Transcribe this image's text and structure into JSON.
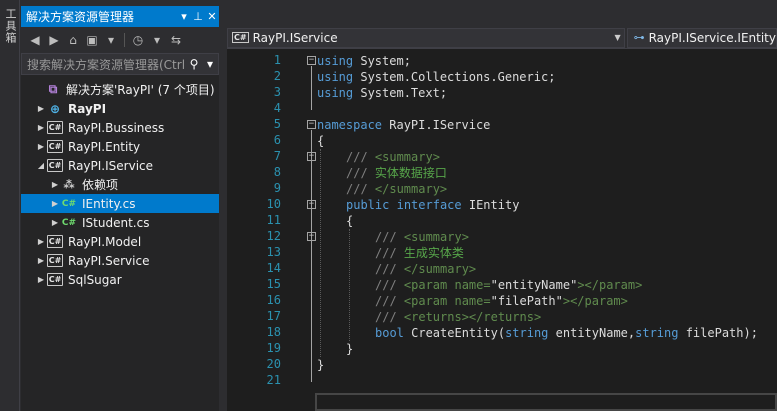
{
  "toolbox": {
    "label": "工具箱"
  },
  "explorer": {
    "title": "解决方案资源管理器",
    "title_buttons": [
      "▾",
      "✕"
    ],
    "search_placeholder": "搜索解决方案资源管理器(Ctrl",
    "tree": [
      {
        "label": "解决方案'RayPI' (7 个项目)",
        "icon": "solution-icon",
        "indent": 0,
        "arrow": "",
        "bold": false
      },
      {
        "label": "RayPI",
        "icon": "web-project-icon",
        "indent": 0,
        "arrow": "▶",
        "bold": true
      },
      {
        "label": "RayPI.Bussiness",
        "icon": "csharp-project-icon",
        "indent": 0,
        "arrow": "▶",
        "bold": false
      },
      {
        "label": "RayPI.Entity",
        "icon": "csharp-project-icon",
        "indent": 0,
        "arrow": "▶",
        "bold": false
      },
      {
        "label": "RayPI.IService",
        "icon": "csharp-project-icon",
        "indent": 0,
        "arrow": "◢",
        "bold": false
      },
      {
        "label": "依赖项",
        "icon": "dependencies-icon",
        "indent": 1,
        "arrow": "▶",
        "bold": false
      },
      {
        "label": "IEntity.cs",
        "icon": "csharp-file-icon",
        "indent": 1,
        "arrow": "▶",
        "bold": false,
        "selected": true
      },
      {
        "label": "IStudent.cs",
        "icon": "csharp-file-icon",
        "indent": 1,
        "arrow": "▶",
        "bold": false
      },
      {
        "label": "RayPI.Model",
        "icon": "csharp-project-icon",
        "indent": 0,
        "arrow": "▶",
        "bold": false
      },
      {
        "label": "RayPI.Service",
        "icon": "csharp-project-icon",
        "indent": 0,
        "arrow": "▶",
        "bold": false
      },
      {
        "label": "SqlSugar",
        "icon": "csharp-project-icon",
        "indent": 0,
        "arrow": "▶",
        "bold": false
      }
    ]
  },
  "editor": {
    "nav_left": "RayPI.IService",
    "nav_right": "RayPI.IService.IEntity",
    "cs_badge": "C#",
    "line_numbers": [
      "1",
      "2",
      "3",
      "4",
      "5",
      "6",
      "7",
      "8",
      "9",
      "10",
      "11",
      "12",
      "13",
      "14",
      "15",
      "16",
      "17",
      "18",
      "19",
      "20",
      "21"
    ],
    "lines": [
      {
        "tokens": [
          [
            "kw",
            "using"
          ],
          [
            "pl",
            " System;"
          ]
        ],
        "indent": 0
      },
      {
        "tokens": [
          [
            "kw",
            "using"
          ],
          [
            "pl",
            " System.Collections.Generic;"
          ]
        ],
        "indent": 0
      },
      {
        "tokens": [
          [
            "kw",
            "using"
          ],
          [
            "pl",
            " System.Text;"
          ]
        ],
        "indent": 0
      },
      {
        "tokens": [],
        "indent": 0
      },
      {
        "tokens": [
          [
            "kw",
            "namespace"
          ],
          [
            "pl",
            " RayPI.IService"
          ]
        ],
        "indent": 0
      },
      {
        "tokens": [
          [
            "pl",
            "{"
          ]
        ],
        "indent": 0
      },
      {
        "tokens": [
          [
            "xt",
            "/// "
          ],
          [
            "cmg",
            "<summary>"
          ]
        ],
        "indent": 1
      },
      {
        "tokens": [
          [
            "xt",
            "/// "
          ],
          [
            "cm",
            "实体数据接口"
          ]
        ],
        "indent": 1
      },
      {
        "tokens": [
          [
            "xt",
            "/// "
          ],
          [
            "cmg",
            "</summary>"
          ]
        ],
        "indent": 1
      },
      {
        "tokens": [
          [
            "kw",
            "public"
          ],
          [
            "pl",
            " "
          ],
          [
            "kw",
            "interface"
          ],
          [
            "pl",
            " IEntity"
          ]
        ],
        "indent": 1
      },
      {
        "tokens": [
          [
            "pl",
            "{"
          ]
        ],
        "indent": 1
      },
      {
        "tokens": [
          [
            "xt",
            "/// "
          ],
          [
            "cmg",
            "<summary>"
          ]
        ],
        "indent": 2
      },
      {
        "tokens": [
          [
            "xt",
            "/// "
          ],
          [
            "cm",
            "生成实体类"
          ]
        ],
        "indent": 2
      },
      {
        "tokens": [
          [
            "xt",
            "/// "
          ],
          [
            "cmg",
            "</summary>"
          ]
        ],
        "indent": 2
      },
      {
        "tokens": [
          [
            "xt",
            "/// "
          ],
          [
            "cmg",
            "<param name="
          ],
          [
            "pl",
            "\"entityName\""
          ],
          [
            "cmg",
            "></param>"
          ]
        ],
        "indent": 2
      },
      {
        "tokens": [
          [
            "xt",
            "/// "
          ],
          [
            "cmg",
            "<param name="
          ],
          [
            "pl",
            "\"filePath\""
          ],
          [
            "cmg",
            "></param>"
          ]
        ],
        "indent": 2
      },
      {
        "tokens": [
          [
            "xt",
            "/// "
          ],
          [
            "cmg",
            "<returns></returns>"
          ]
        ],
        "indent": 2
      },
      {
        "tokens": [
          [
            "kw",
            "bool"
          ],
          [
            "pl",
            " CreateEntity("
          ],
          [
            "kw",
            "string"
          ],
          [
            "pl",
            " entityName,"
          ],
          [
            "kw",
            "string"
          ],
          [
            "pl",
            " filePath);"
          ]
        ],
        "indent": 2
      },
      {
        "tokens": [
          [
            "pl",
            "}"
          ]
        ],
        "indent": 1
      },
      {
        "tokens": [
          [
            "pl",
            "}"
          ]
        ],
        "indent": 0
      },
      {
        "tokens": [],
        "indent": 0
      }
    ]
  },
  "colors": {
    "accent": "#007acc",
    "editor_bg": "#1e1e1e",
    "panel_bg": "#252526",
    "line_number": "#2b91af",
    "keyword": "#569cd6",
    "comment": "#57a64a"
  }
}
